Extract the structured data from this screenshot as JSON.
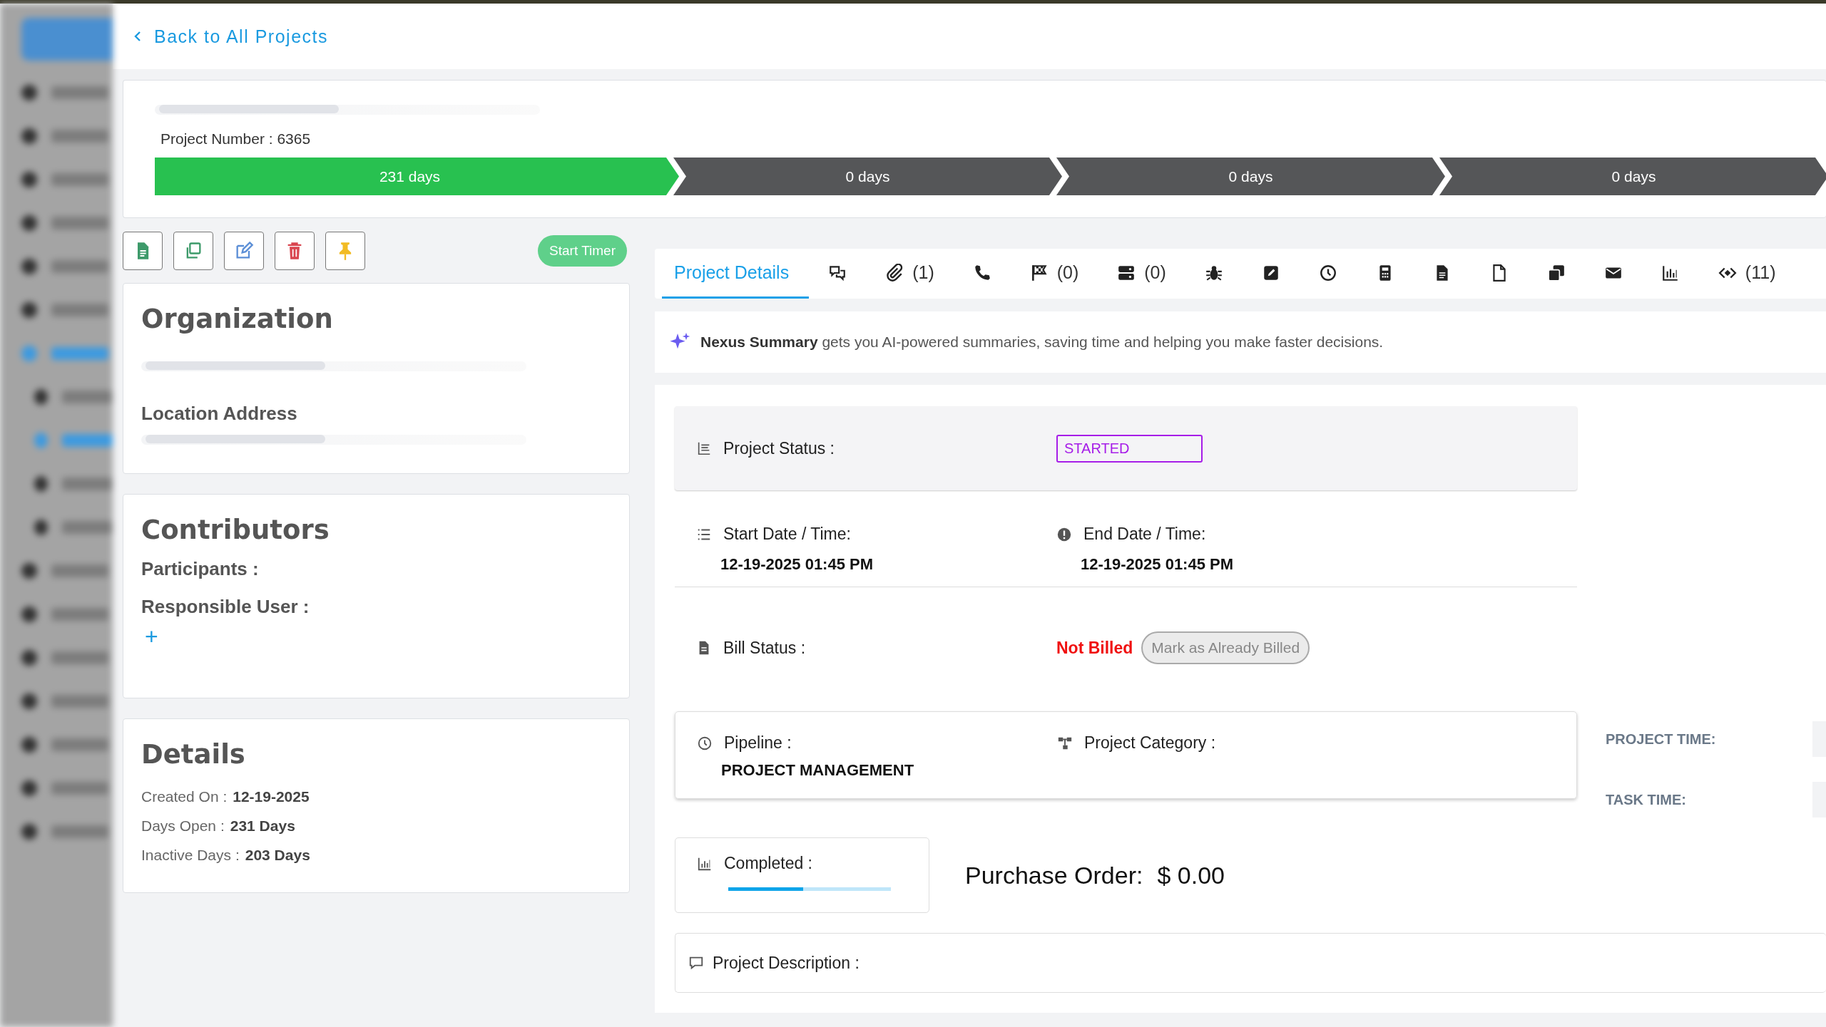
{
  "back_link": "Back to All Projects",
  "header": {
    "project_number_label": "Project Number : 6365",
    "stages": [
      {
        "label": "231 days",
        "active": true
      },
      {
        "label": "0 days",
        "active": false
      },
      {
        "label": "0 days",
        "active": false
      },
      {
        "label": "0 days",
        "active": false
      }
    ]
  },
  "timer_button": "Start Timer",
  "organization": {
    "title": "Organization",
    "location_label": "Location Address"
  },
  "contributors": {
    "title": "Contributors",
    "participants_label": "Participants :",
    "responsible_label": "Responsible User :",
    "add": "+"
  },
  "details": {
    "title": "Details",
    "rows": [
      {
        "label": "Created On :",
        "value": "12-19-2025"
      },
      {
        "label": "Days Open :",
        "value": "231 Days"
      },
      {
        "label": "Inactive Days :",
        "value": "203 Days"
      }
    ]
  },
  "tabs": [
    {
      "label": "Project Details",
      "selected": true
    },
    {
      "selected": false
    },
    {
      "count": "(1)",
      "selected": false
    },
    {
      "selected": false
    },
    {
      "count": "(0)",
      "selected": false
    },
    {
      "count": "(0)",
      "selected": false
    },
    {
      "selected": false
    },
    {
      "selected": false
    },
    {
      "selected": false
    },
    {
      "selected": false
    },
    {
      "selected": false
    },
    {
      "selected": false
    },
    {
      "selected": false
    },
    {
      "selected": false
    },
    {
      "selected": false
    },
    {
      "count": "(11)",
      "selected": false
    }
  ],
  "summary": "**Nexus Summary** gets you AI-powered summaries, saving time and helping you make faster decisions.",
  "project_status": {
    "label": "Project Status :",
    "value": "STARTED",
    "color": "#a61de8"
  },
  "start": {
    "label": "Start Date / Time:",
    "value": "12-19-2025 01:45 PM"
  },
  "end": {
    "label": "End Date / Time:",
    "value": "12-19-2025 01:45 PM"
  },
  "bill": {
    "label": "Bill Status :",
    "value": "Not Billed",
    "color": "#f01010",
    "button": "Mark as Already Billed"
  },
  "pipeline": {
    "label": "Pipeline :",
    "value": "PROJECT MANAGEMENT"
  },
  "category": {
    "label": "Project Category :"
  },
  "times": [
    {
      "label": "PROJECT TIME:"
    },
    {
      "label": "TASK TIME:"
    }
  ],
  "completed": {
    "label": "Completed :",
    "level": 0.46
  },
  "purchase_order": {
    "label": "Purchase Order:",
    "value": "$ 0.00"
  },
  "description": {
    "label": "Project Description :"
  }
}
